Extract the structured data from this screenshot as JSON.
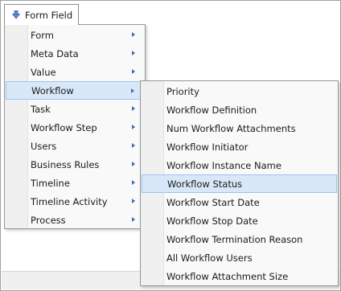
{
  "form_field_button": {
    "label": "Form Field",
    "icon": "down-arrow-icon"
  },
  "main_menu": {
    "items": [
      {
        "label": "Form"
      },
      {
        "label": "Meta Data"
      },
      {
        "label": "Value"
      },
      {
        "label": "Workflow",
        "selected": true
      },
      {
        "label": "Task"
      },
      {
        "label": "Workflow Step"
      },
      {
        "label": "Users"
      },
      {
        "label": "Business Rules"
      },
      {
        "label": "Timeline"
      },
      {
        "label": "Timeline Activity"
      },
      {
        "label": "Process"
      }
    ]
  },
  "submenu": {
    "items": [
      {
        "label": "Priority"
      },
      {
        "label": "Workflow Definition"
      },
      {
        "label": "Num Workflow Attachments"
      },
      {
        "label": "Workflow Initiator"
      },
      {
        "label": "Workflow Instance Name"
      },
      {
        "label": "Workflow Status",
        "selected": true
      },
      {
        "label": "Workflow Start Date"
      },
      {
        "label": "Workflow Stop Date"
      },
      {
        "label": "Workflow Termination Reason"
      },
      {
        "label": "All Workflow Users"
      },
      {
        "label": "Workflow Attachment Size"
      }
    ]
  },
  "colors": {
    "highlight_fill": "#d8e8f8",
    "highlight_border": "#9cc3ea",
    "arrow": "#3d6fb6"
  }
}
